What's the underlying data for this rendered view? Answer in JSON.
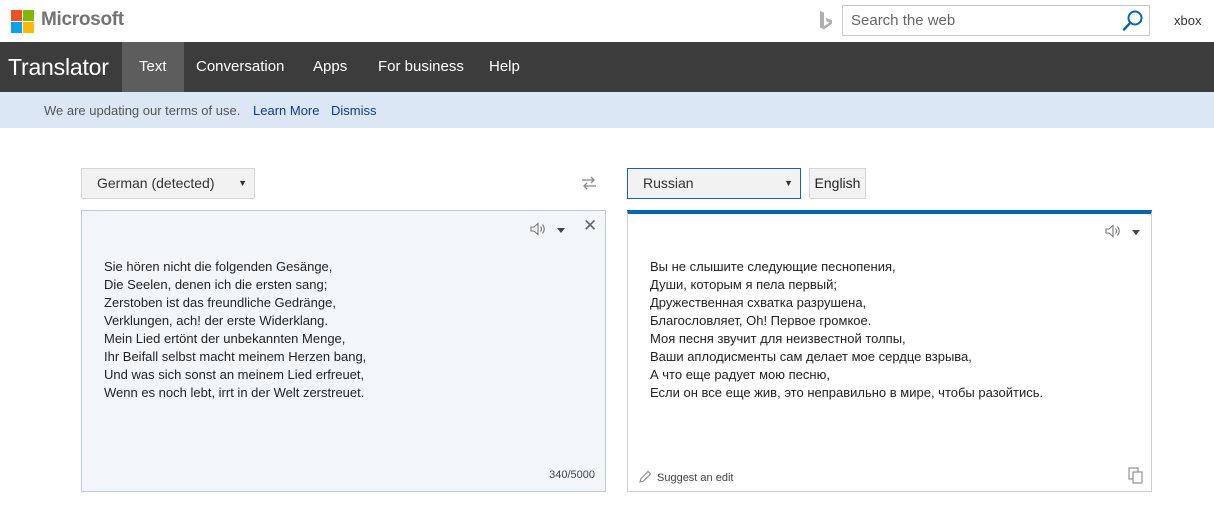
{
  "header": {
    "brand": "Microsoft",
    "logo_colors": [
      "#f25022",
      "#7fba00",
      "#00a4ef",
      "#ffb900"
    ],
    "search": {
      "placeholder": "Search the web",
      "value": ""
    },
    "user": "xbox"
  },
  "nav": {
    "app_title": "Translator",
    "tabs": [
      {
        "label": "Text",
        "active": true
      },
      {
        "label": "Conversation",
        "active": false
      },
      {
        "label": "Apps",
        "active": false
      },
      {
        "label": "For business",
        "active": false
      },
      {
        "label": "Help",
        "active": false
      }
    ]
  },
  "notice": {
    "message": "We are updating our terms of use.",
    "learn_more": "Learn More",
    "dismiss": "Dismiss"
  },
  "source": {
    "language": "German (detected)",
    "text": "Sie hören nicht die folgenden Gesänge,\nDie Seelen, denen ich die ersten sang;\nZerstoben ist das freundliche Gedränge,\nVerklungen, ach! der erste Widerklang.\nMein Lied ertönt der unbekannten Menge,\nIhr Beifall selbst macht meinem Herzen bang,\nUnd was sich sonst an meinem Lied erfreuet,\nWenn es noch lebt, irrt in der Welt zerstreuet.",
    "char_count": "340/5000"
  },
  "target": {
    "language": "Russian",
    "quick_language": "English",
    "text": "Вы не слышите следующие песнопения,\nДуши, которым я пела первый;\nДружественная схватка разрушена,\nБлагословляет, Oh! Первое громкое.\nМоя песня звучит для неизвестной толпы,\nВаши аплодисменты сам делает мое сердце взрыва,\nА что еще радует мою песню,\nЕсли он все еще жив, это неправильно в мире, чтобы разойтись.",
    "suggest_edit": "Suggest an edit"
  },
  "colors": {
    "nav_bg": "#3c3c3c",
    "nav_active": "#5d5d5d",
    "notice_bg": "#dce7f5",
    "accent": "#0067b8",
    "link": "#0b3d91"
  }
}
